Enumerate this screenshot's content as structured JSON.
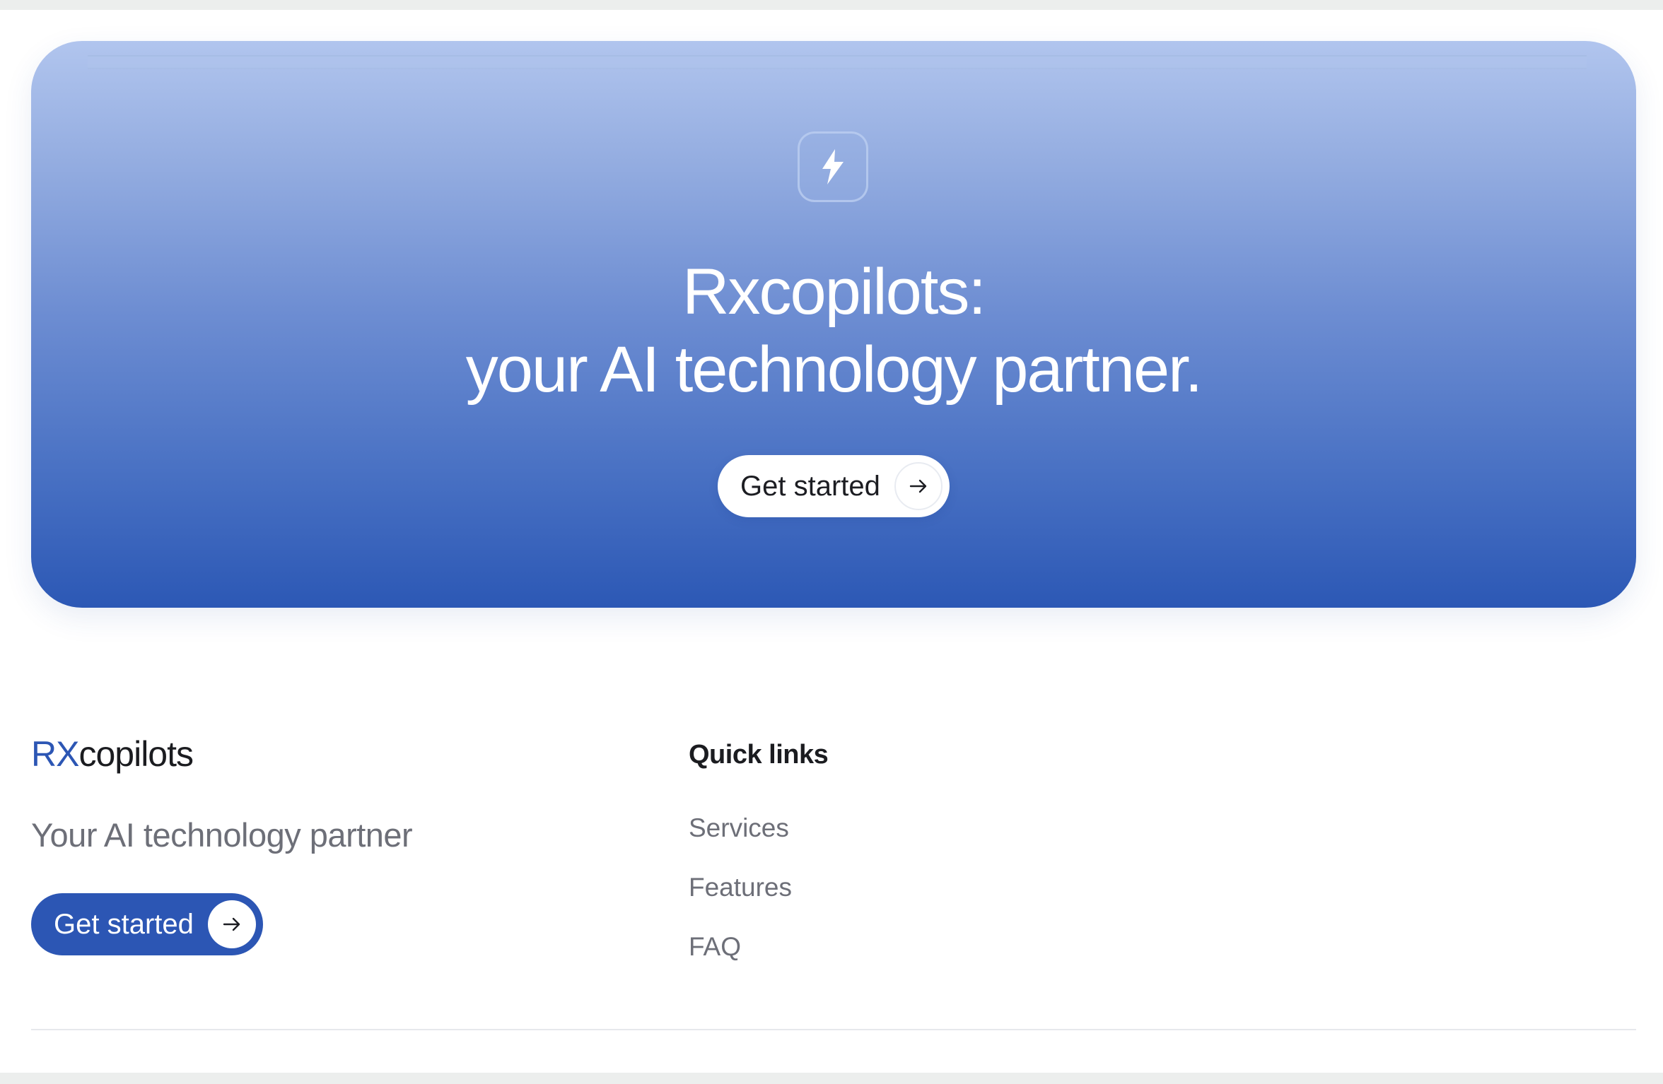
{
  "hero": {
    "icon": "bolt-icon",
    "title_line1": "Rxcopilots:",
    "title_line2": "your AI technology partner.",
    "cta_label": "Get started",
    "cta_icon": "arrow-right-icon"
  },
  "footer": {
    "brand_accent": "RX",
    "brand_rest": "copilots",
    "tagline": "Your AI technology partner",
    "cta_label": "Get started",
    "cta_icon": "arrow-right-icon",
    "quick_links": {
      "heading": "Quick links",
      "items": [
        "Services",
        "Features",
        "FAQ"
      ]
    }
  },
  "colors": {
    "brand_blue": "#2c56b4",
    "hero_gradient_top": "#b1c5ee",
    "hero_gradient_bottom": "#2c58b5",
    "muted_text": "#6d6f78",
    "dark_text": "#1b1c20"
  }
}
